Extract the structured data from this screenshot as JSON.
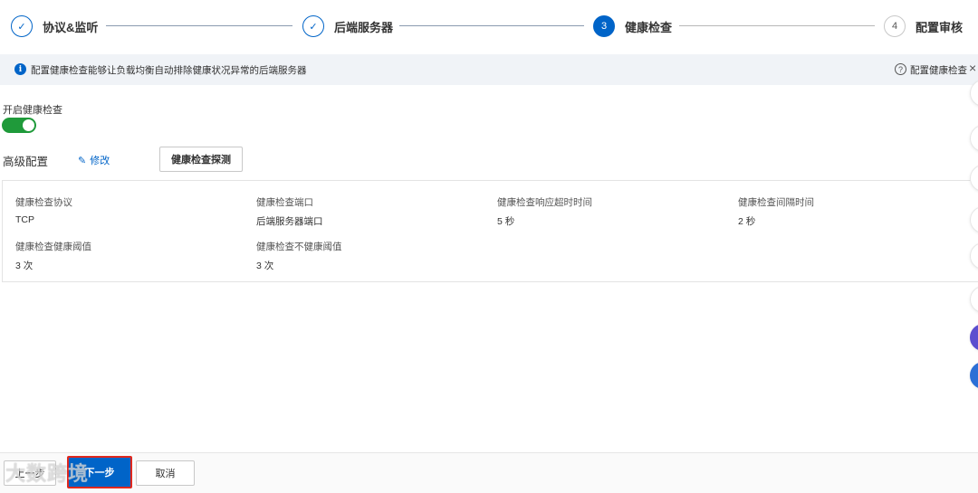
{
  "stepper": {
    "steps": [
      {
        "label": "协议&监听",
        "state": "done",
        "marker": "✓"
      },
      {
        "label": "后端服务器",
        "state": "done",
        "marker": "✓"
      },
      {
        "label": "健康检查",
        "state": "active",
        "marker": "3"
      },
      {
        "label": "配置审核",
        "state": "pending",
        "marker": "4"
      }
    ]
  },
  "banner": {
    "info_icon": "info-icon",
    "text": "配置健康检查能够让负载均衡自动排除健康状况异常的后端服务器",
    "help_text": "配置健康检查",
    "help_marker": "?",
    "close_marker": "×"
  },
  "health_check": {
    "label": "开启健康检查",
    "enabled": true,
    "toggle_color": "#1f9a3a"
  },
  "advanced": {
    "label": "高级配置",
    "edit_label": "修改",
    "edit_icon": "✎",
    "probe_button": "健康检查探测"
  },
  "config": [
    {
      "label": "健康检查协议",
      "value": "TCP"
    },
    {
      "label": "健康检查端口",
      "value": "后端服务器端口"
    },
    {
      "label": "健康检查响应超时时间",
      "value": "5 秒"
    },
    {
      "label": "健康检查间隔时间",
      "value": "2 秒"
    },
    {
      "label": "健康检查健康阈值",
      "value": "3 次"
    },
    {
      "label": "健康检查不健康阈值",
      "value": "3 次"
    }
  ],
  "footer": {
    "prev_label": "上一步",
    "next_label": "下一步",
    "cancel_label": "取消",
    "watermark": "大数跨境"
  },
  "colors": {
    "accent": "#0064c8",
    "highlight_border": "#e0281e"
  }
}
